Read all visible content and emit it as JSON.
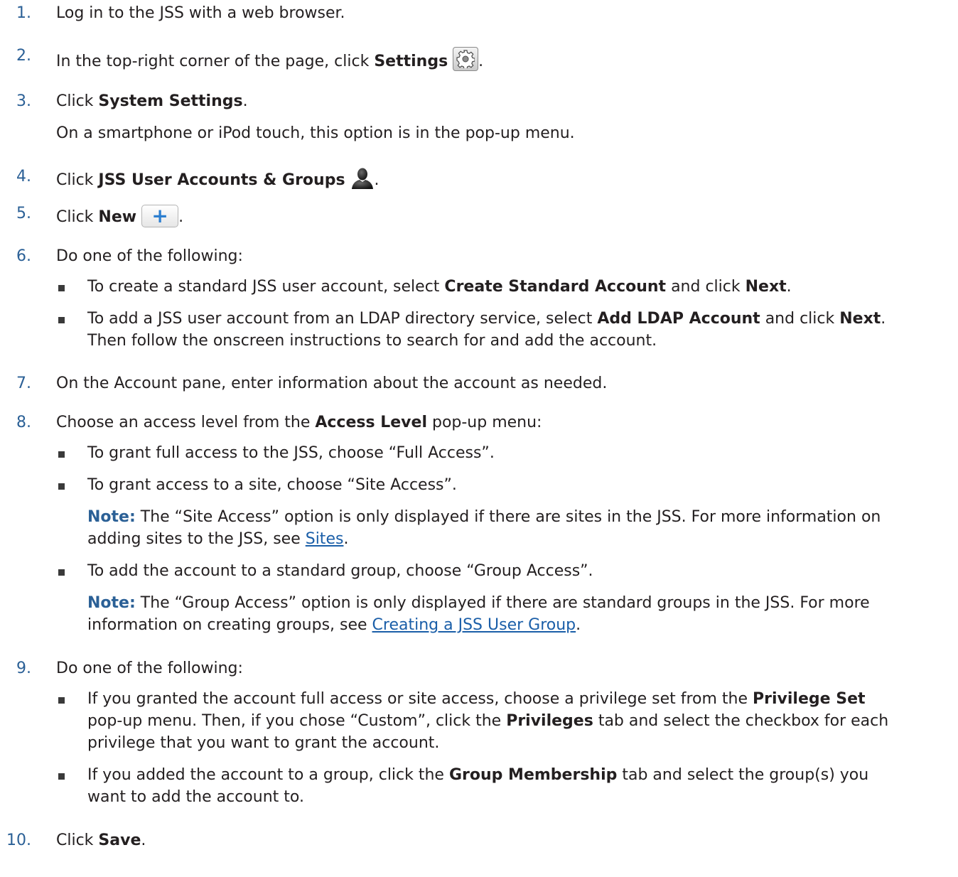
{
  "steps": [
    {
      "n": "1.",
      "text": "Log in to the JSS with a web browser."
    },
    {
      "n": "2.",
      "pre": "In the top-right corner of the page, click ",
      "b": "Settings",
      "post": "."
    },
    {
      "n": "3.",
      "pre": "Click ",
      "b": "System Settings",
      "post": ".",
      "sub": "On a smartphone or iPod touch, this option is in the pop-up menu."
    },
    {
      "n": "4.",
      "pre": "Click ",
      "b": "JSS User Accounts & Groups",
      "post": "."
    },
    {
      "n": "5.",
      "pre": "Click ",
      "b": "New",
      "post": "."
    },
    {
      "n": "6.",
      "text": "Do one of the following:"
    },
    {
      "n": "7.",
      "text": "On the Account pane, enter information about the account as needed."
    },
    {
      "n": "8.",
      "pre": "Choose an access level from the ",
      "b": "Access Level",
      "post": " pop-up menu:"
    },
    {
      "n": "9.",
      "text": "Do one of the following:"
    },
    {
      "n": "10.",
      "pre": "Click ",
      "b": "Save",
      "post": "."
    }
  ],
  "step6": {
    "b1_pre": "To create a standard JSS user account, select ",
    "b1_b1": "Create Standard Account",
    "b1_mid": " and click ",
    "b1_b2": "Next",
    "b1_post": ".",
    "b2_pre": "To add a JSS user account from an LDAP directory service, select ",
    "b2_b1": "Add LDAP Account",
    "b2_mid": " and click ",
    "b2_b2": "Next",
    "b2_post": ".",
    "b2_line2": "Then follow the onscreen instructions to search for and add the account."
  },
  "step8": {
    "b1": "To grant full access to the JSS, choose “Full Access”.",
    "b2": "To grant access to a site, choose “Site Access”.",
    "note_label": "Note:",
    "note1_l1": " The “Site Access” option is only displayed if there are sites in the JSS. For more information on",
    "note1_l2_pre": "adding sites to the JSS, see ",
    "note1_link": "Sites",
    "note1_l2_post": ".",
    "b3": "To add the account to a standard group, choose “Group Access”.",
    "note2_l1": " The “Group Access” option is only displayed if there are standard groups in the JSS. For more",
    "note2_l2_pre": "information on creating groups, see ",
    "note2_link": "Creating a JSS User Group",
    "note2_l2_post": "."
  },
  "step9": {
    "b1_pre": "If you granted the account full access or site access, choose a privilege set from the ",
    "b1_b1": "Privilege Set",
    "b1_l2_pre": "pop-up menu. Then, if you chose “Custom”, click the ",
    "b1_b2": "Privileges",
    "b1_l2_post": " tab and select the checkbox for each",
    "b1_l3": "privilege that you want to grant the account.",
    "b2_pre": "If you added the account to a group, click the ",
    "b2_b1": "Group Membership",
    "b2_post": " tab and select the group(s) you",
    "b2_l2": "want to add the account to."
  },
  "icons": {
    "settings": "gear-icon",
    "accounts": "person-icon",
    "new": "plus-icon"
  },
  "colors": {
    "number": "#2b6096",
    "note": "#2b6096",
    "link": "#1a5ea8",
    "new_plus": "#2d7fd0"
  }
}
